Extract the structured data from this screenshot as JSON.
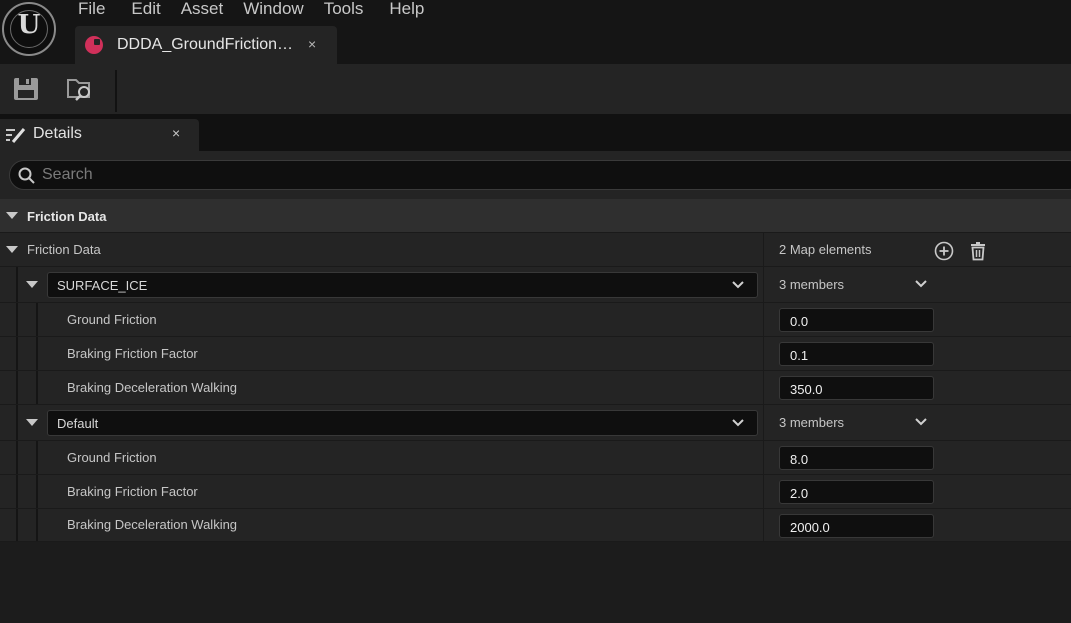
{
  "menu": [
    "File",
    "Edit",
    "Asset",
    "Window",
    "Tools",
    "Help"
  ],
  "document_tab": {
    "label": "DDDA_GroundFriction…",
    "close": "×"
  },
  "toolbar": {
    "save": "save-icon",
    "browse": "browse-to-asset-icon"
  },
  "details_panel": {
    "tab_label": "Details",
    "close": "×",
    "search_placeholder": "Search",
    "category": "Friction Data"
  },
  "property": {
    "label": "Friction Data",
    "value": "2 Map elements"
  },
  "entries": [
    {
      "key": "SURFACE_ICE",
      "members": "3 members",
      "fields": [
        {
          "label": "Ground Friction",
          "value": "0.0"
        },
        {
          "label": "Braking Friction Factor",
          "value": "0.1"
        },
        {
          "label": "Braking Deceleration Walking",
          "value": "350.0"
        }
      ]
    },
    {
      "key": "Default",
      "members": "3 members",
      "fields": [
        {
          "label": "Ground Friction",
          "value": "8.0"
        },
        {
          "label": "Braking Friction Factor",
          "value": "2.0"
        },
        {
          "label": "Braking Deceleration Walking",
          "value": "2000.0"
        }
      ]
    }
  ],
  "colors": {
    "asset_icon": "#d0305a",
    "panel_bg": "#242424",
    "field_bg": "#0f0f0f"
  }
}
